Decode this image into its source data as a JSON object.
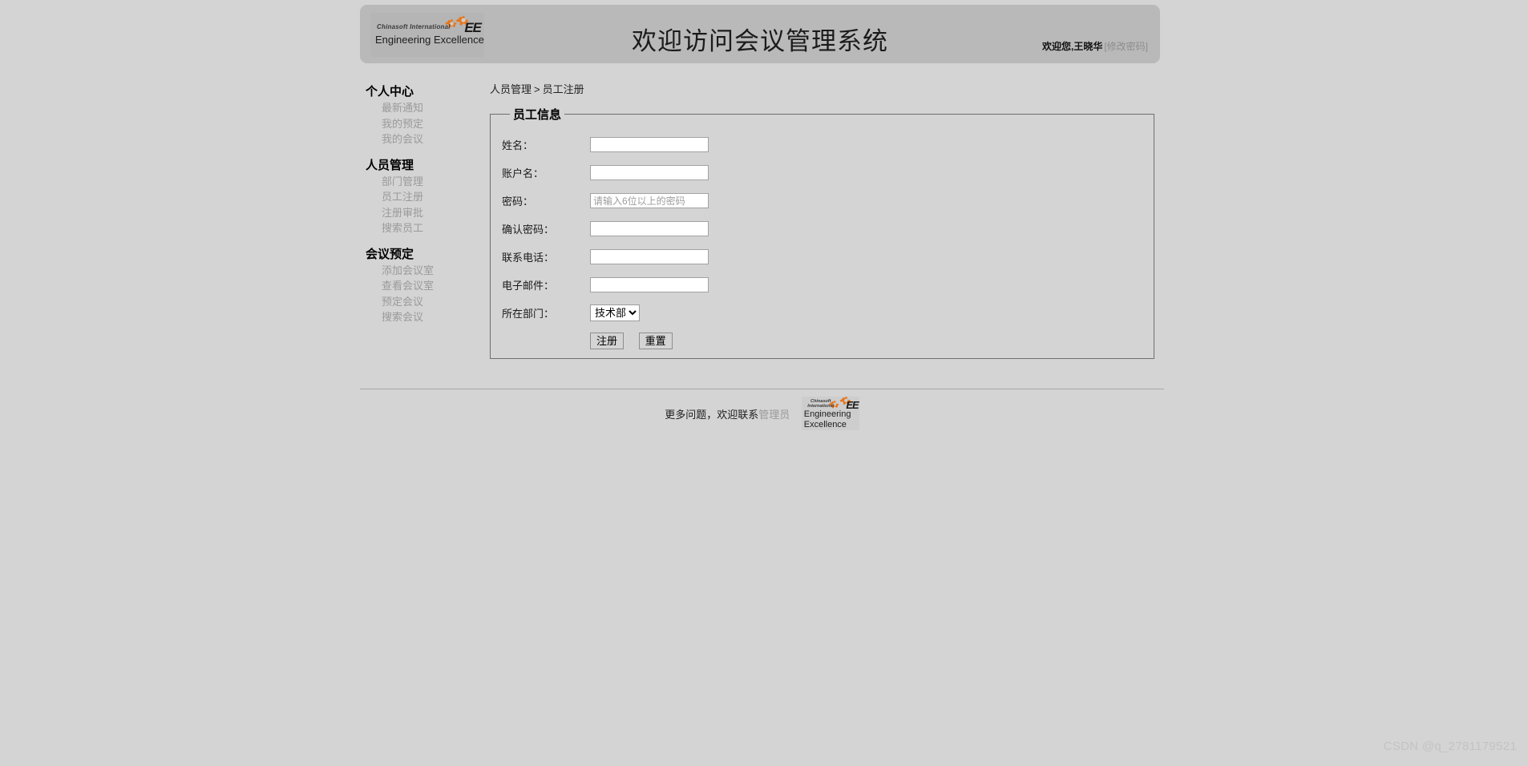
{
  "header": {
    "title": "欢迎访问会议管理系统",
    "welcome_text": "欢迎您,王晓华",
    "change_password_label": "[修改密码]",
    "logo": {
      "line1": "Chinasoft International",
      "line2": "Engineering Excellence",
      "monogram": "EE"
    }
  },
  "sidebar": {
    "groups": [
      {
        "title": "个人中心",
        "items": [
          {
            "label": "最新通知"
          },
          {
            "label": "我的预定"
          },
          {
            "label": "我的会议"
          }
        ]
      },
      {
        "title": "人员管理",
        "items": [
          {
            "label": "部门管理"
          },
          {
            "label": "员工注册"
          },
          {
            "label": "注册审批"
          },
          {
            "label": "搜索员工"
          }
        ]
      },
      {
        "title": "会议预定",
        "items": [
          {
            "label": "添加会议室"
          },
          {
            "label": "查看会议室"
          },
          {
            "label": "预定会议"
          },
          {
            "label": "搜索会议"
          }
        ]
      }
    ]
  },
  "breadcrumb": {
    "parent": "人员管理",
    "separator": ">",
    "current": "员工注册"
  },
  "form": {
    "legend": "员工信息",
    "fields": [
      {
        "label": "姓名：",
        "value": "",
        "placeholder": ""
      },
      {
        "label": "账户名：",
        "value": "",
        "placeholder": ""
      },
      {
        "label": "密码：",
        "value": "",
        "placeholder": "请输入6位以上的密码"
      },
      {
        "label": "确认密码：",
        "value": "",
        "placeholder": ""
      },
      {
        "label": "联系电话：",
        "value": "",
        "placeholder": ""
      },
      {
        "label": "电子邮件：",
        "value": "",
        "placeholder": ""
      }
    ],
    "department": {
      "label": "所在部门：",
      "selected": "技术部",
      "options": [
        "技术部"
      ]
    },
    "submit_label": "注册",
    "reset_label": "重置"
  },
  "footer": {
    "text": "更多问题，欢迎联系",
    "admin_link": "管理员",
    "logo": {
      "line1": "Chinasoft",
      "line1b": "International",
      "line2": "Engineering",
      "line3": "Excellence",
      "monogram": "EE"
    }
  },
  "watermark": "CSDN @q_2781179521",
  "colors": {
    "page_bg": "#d4d4d4",
    "header_bg": "#b9b9b9",
    "link_gray": "#9a9a9a",
    "border": "#6f6f6f",
    "logo_orange": "#e8761a"
  }
}
